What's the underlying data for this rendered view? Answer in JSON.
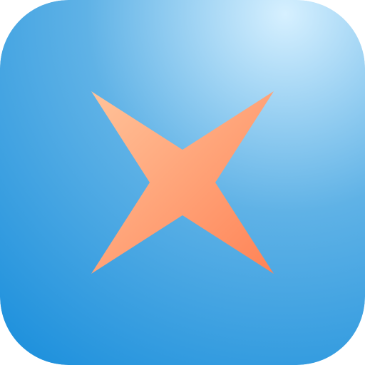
{
  "app_icon": {
    "icon_name": "four-point-star-icon",
    "colors": {
      "background_light": "#d6f0ff",
      "background_mid": "#5fb2e6",
      "background_dark": "#1b8fdc",
      "star_light": "#ffc39a",
      "star_dark": "#ff8356"
    }
  }
}
